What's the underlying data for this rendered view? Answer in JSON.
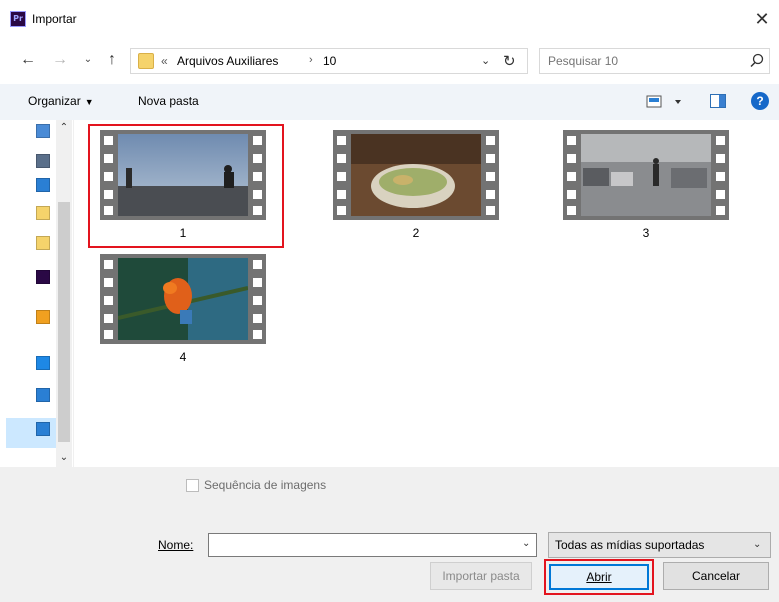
{
  "window": {
    "app_icon_text": "Pr",
    "title": "Importar",
    "close_glyph": "✕"
  },
  "nav": {
    "back_glyph": "←",
    "forward_glyph": "→",
    "recent_glyph": "⌄",
    "up_glyph": "↑"
  },
  "address": {
    "overflow": "«",
    "crumbs": [
      "Arquivos Auxiliares",
      "10"
    ],
    "separator": "›",
    "dropdown_glyph": "⌄",
    "refresh_glyph": "↻"
  },
  "search": {
    "placeholder": "Pesquisar 10"
  },
  "toolbar": {
    "organize_label": "Organizar",
    "organize_caret": "▼",
    "new_folder_label": "Nova pasta",
    "help_label": "?"
  },
  "navpane": {
    "scroll_up": "⌃",
    "scroll_down": "⌄",
    "icons": [
      {
        "name": "document-icon",
        "color": "#4a8bd6"
      },
      {
        "name": "document-icon",
        "color": "#5a6f8a"
      },
      {
        "name": "desktop-icon",
        "color": "#2a7fd4"
      },
      {
        "name": "folder-icon",
        "color": "#f5d36b"
      },
      {
        "name": "folder-icon",
        "color": "#f5d36b"
      },
      {
        "name": "premiere-icon",
        "color": "#2a0845"
      },
      {
        "name": "creative-cloud-icon",
        "color": "#f0a020"
      },
      {
        "name": "onedrive-icon",
        "color": "#1e88e5"
      },
      {
        "name": "computer-icon",
        "color": "#2a7fd4"
      },
      {
        "name": "network-icon",
        "color": "#2a7fd4"
      }
    ]
  },
  "files": [
    {
      "label": "1",
      "selected": true
    },
    {
      "label": "2",
      "selected": false
    },
    {
      "label": "3",
      "selected": false
    },
    {
      "label": "4",
      "selected": false
    }
  ],
  "bottom": {
    "sequence_label": "Sequência de imagens",
    "name_label": "Nome:",
    "name_value": "",
    "filter_value": "Todas as mídias suportadas",
    "filter_chevron": "⌄",
    "import_folder_label": "Importar pasta",
    "open_label": "Abrir",
    "cancel_label": "Cancelar"
  },
  "colors": {
    "highlight": "#e3141e",
    "accent": "#0078d7"
  }
}
